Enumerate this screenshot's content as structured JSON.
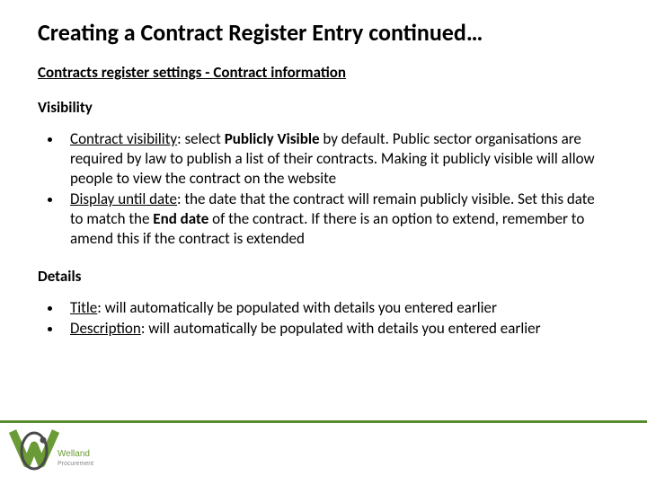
{
  "title": "Creating a Contract Register Entry continued…",
  "subtitle": "Contracts register settings - Contract information",
  "visibility": {
    "heading": "Visibility",
    "items": [
      {
        "label": "Contract visibility",
        "text": ": select ",
        "bold1": "Publicly Visible",
        "rest": " by default. Public sector organisations are required by law to publish a list of their contracts. Making it publicly visible will allow people to view the contract on the website"
      },
      {
        "label": "Display until date",
        "text": ": the date that the contract will remain publicly visible. Set this date to match the ",
        "bold1": "End date",
        "rest": " of the contract. If there is an option to extend, remember to amend this if the contract is extended"
      }
    ]
  },
  "details": {
    "heading": "Details",
    "items": [
      {
        "label": "Title",
        "text": ": will automatically be populated with details you entered earlier"
      },
      {
        "label": "Description",
        "text": ": will automatically be populated with details you entered earlier"
      }
    ]
  },
  "logo": {
    "name": "Welland Procurement"
  }
}
